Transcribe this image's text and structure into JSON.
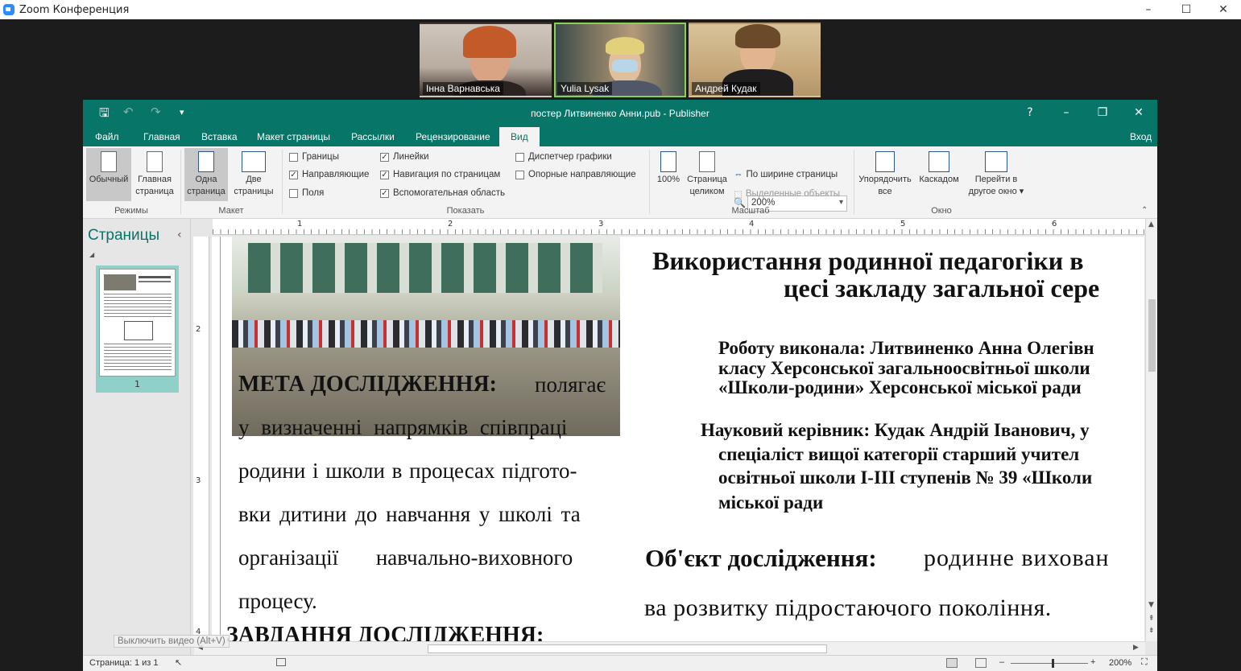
{
  "zoom": {
    "window_title": "Zoom Конференция",
    "controls": {
      "minimize": "–",
      "maximize": "☐",
      "close": "✕"
    },
    "participants": [
      {
        "name": "Інна Варнавська",
        "active": false
      },
      {
        "name": "Yulia Lysak",
        "active": true
      },
      {
        "name": "Андрей Кудак",
        "active": false
      }
    ],
    "tooltip": "Выключить видео (Alt+V)"
  },
  "publisher": {
    "title": "постер Литвиненко Анни.pub - Publisher",
    "title_controls": {
      "help": "?",
      "minimize": "–",
      "restore": "❐",
      "close": "✕"
    },
    "tabs": [
      "Файл",
      "Главная",
      "Вставка",
      "Макет страницы",
      "Рассылки",
      "Рецензирование",
      "Вид"
    ],
    "selected_tab": "Вид",
    "signin": "Вход",
    "ribbon": {
      "modes": {
        "label": "Режимы",
        "normal": "Обычный",
        "master": [
          "Главная",
          "страница"
        ]
      },
      "layout": {
        "label": "Макет",
        "single": [
          "Одна",
          "страница"
        ],
        "two": [
          "Две",
          "страницы"
        ]
      },
      "show": {
        "label": "Показать",
        "items": [
          {
            "text": "Границы",
            "checked": false
          },
          {
            "text": "Направляющие",
            "checked": true
          },
          {
            "text": "Поля",
            "checked": false
          },
          {
            "text": "Линейки",
            "checked": true
          },
          {
            "text": "Навигация по страницам",
            "checked": true
          },
          {
            "text": "Вспомогательная область",
            "checked": true
          },
          {
            "text": "Диспетчер графики",
            "checked": false
          },
          {
            "text": "Опорные направляющие",
            "checked": false
          }
        ]
      },
      "zoom": {
        "label": "Масштаб",
        "hundred": "100%",
        "whole_page": [
          "Страница",
          "целиком"
        ],
        "value": "200%",
        "page_width": "По ширине страницы",
        "selected_objects": "Выделенные объекты"
      },
      "window": {
        "label": "Окно",
        "arrange": [
          "Упорядочить",
          "все"
        ],
        "cascade": "Каскадом",
        "switch": [
          "Перейти в",
          "другое окно ▾"
        ]
      }
    },
    "pages_pane": {
      "title": "Страницы",
      "collapse": "‹",
      "page_number": "1"
    },
    "ruler_numbers": [
      "1",
      "2",
      "3",
      "4",
      "5",
      "6"
    ],
    "ruler_left_numbers": [
      "2",
      "3",
      "4"
    ],
    "document": {
      "goal_lines": [
        {
          "bold": "МЕТА ДОСЛІДЖЕННЯ: ",
          "text": "полягає"
        },
        {
          "bold": "",
          "text": "у визначенні напрямків співпраці"
        },
        {
          "bold": "",
          "text": "родини і школи в процесах підгото-"
        },
        {
          "bold": "",
          "text": "вки дитини до навчання у школі та"
        },
        {
          "bold": "",
          "text": "організації навчально-виховного"
        },
        {
          "bold": "",
          "text": "процесу."
        }
      ],
      "tasks_heading": "ЗАВДАННЯ ДОСЛІДЖЕННЯ:",
      "title_lines": [
        "Використання родинної педагогіки в",
        "цесі закладу загальної сере"
      ],
      "author_lines": [
        "Роботу виконала:  Литвиненко Анна Олегівн",
        "класу  Херсонської загальноосвітньої  школи",
        "«Школи-родини» Херсонської міської ради"
      ],
      "advisor_lines": [
        "Науковий керівник: Кудак Андрій Іванович, у",
        "спеціаліст вищої категорії   старший учител",
        "освітньої  школи І-ІІІ ступенів № 39 «Школи",
        "міської ради"
      ],
      "object_bold": "Об'єкт дослідження: ",
      "object_text": "родинне вихован",
      "object_line2": "ва розвитку підростаючого покоління."
    },
    "status": {
      "page_info": "Страница: 1 из 1",
      "zoom_minus": "–",
      "zoom_plus": "+",
      "zoom_level": "200%"
    }
  }
}
